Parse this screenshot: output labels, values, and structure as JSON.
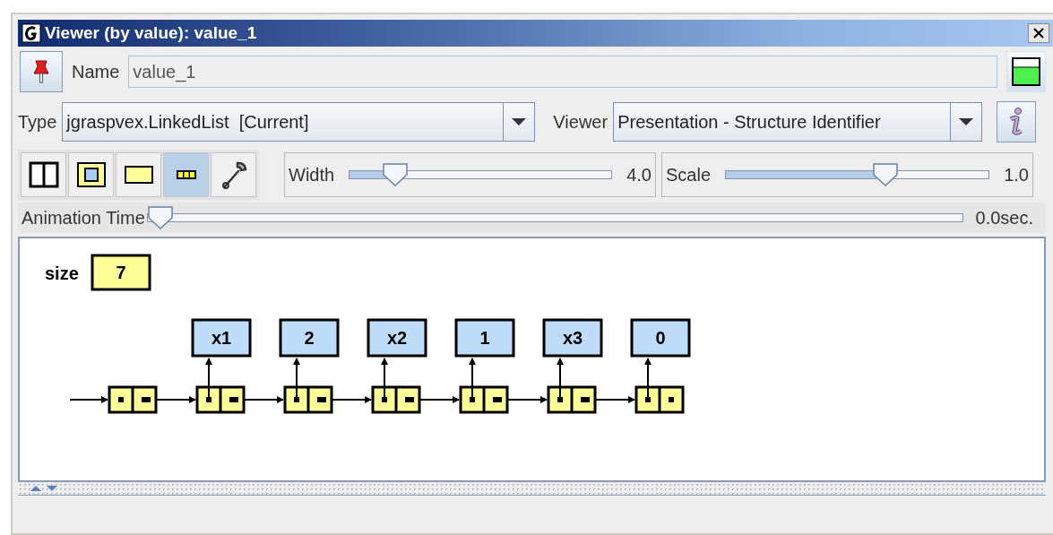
{
  "window": {
    "title": "Viewer (by value): value_1"
  },
  "name_field": {
    "label": "Name",
    "value": "value_1"
  },
  "type_field": {
    "label": "Type",
    "value": "jgraspvex.LinkedList  [Current]"
  },
  "viewer_field": {
    "label": "Viewer",
    "value": "Presentation - Structure Identifier"
  },
  "toolbar": [
    {
      "kind": "split",
      "selected": false
    },
    {
      "kind": "boxed",
      "selected": false
    },
    {
      "kind": "plain",
      "selected": false
    },
    {
      "kind": "chain",
      "selected": true
    },
    {
      "kind": "wrench",
      "selected": false
    }
  ],
  "width_slider": {
    "label": "Width",
    "level": 0.14,
    "reading": "4.0"
  },
  "scale_slider": {
    "label": "Scale",
    "level": 0.62,
    "reading": "1.0"
  },
  "animation_slider": {
    "label": "Animation Time",
    "level": 0,
    "reading": "0.0sec."
  },
  "canvas": {
    "size_label": "size",
    "size_value": "7",
    "values": [
      "x1",
      "2",
      "x2",
      "1",
      "x3",
      "0"
    ]
  }
}
